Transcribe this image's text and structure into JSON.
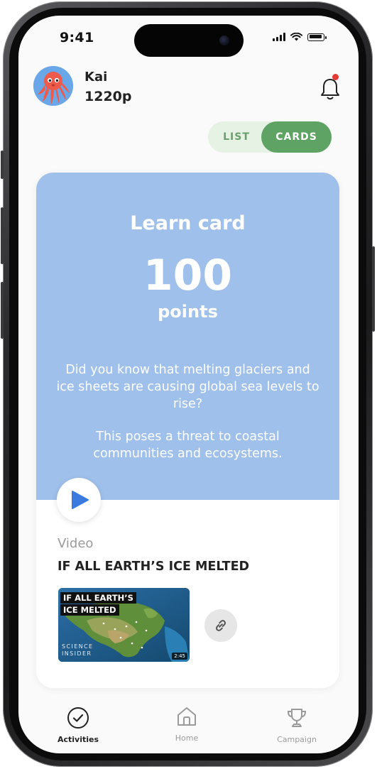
{
  "status_bar": {
    "time": "9:41"
  },
  "header": {
    "user_name": "Kai",
    "user_points": "1220p",
    "avatar_icon": "octopus-avatar",
    "notification_icon": "bell-icon",
    "notification_dot_color": "#e53935"
  },
  "view_toggle": {
    "options": [
      "LIST",
      "CARDS"
    ],
    "selected": "CARDS"
  },
  "card": {
    "title": "Learn card",
    "points_value": "100",
    "points_label": "points",
    "text_paragraph_1": "Did you know that melting glaciers and ice sheets are causing global sea levels to rise?",
    "text_paragraph_2": "This poses a threat to coastal communities and ecosystems.",
    "top_color": "#9fc0eb",
    "media_type": "Video",
    "media_title": "IF ALL EARTH’S ICE MELTED",
    "thumbnail": {
      "caption_line_1": "IF ALL EARTH’S",
      "caption_line_2": "ICE MELTED",
      "brand_line_1": "SCIENCE",
      "brand_line_2": "INSIDER",
      "duration": "2:45"
    }
  },
  "tab_bar": {
    "tabs": [
      {
        "label": "Activities",
        "icon": "check-circle-icon",
        "active": true
      },
      {
        "label": "Home",
        "icon": "home-icon",
        "active": false
      },
      {
        "label": "Campaign",
        "icon": "trophy-icon",
        "active": false
      }
    ]
  },
  "colors": {
    "accent_green": "#5fa364",
    "toggle_bg": "#e5f2e4",
    "play_blue": "#3b7be0"
  }
}
